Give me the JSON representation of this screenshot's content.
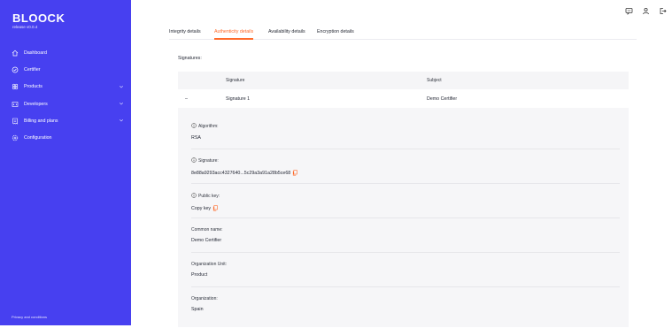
{
  "sidebar": {
    "logo": "BLOOCK",
    "release": "release v0.0.4",
    "items": [
      {
        "label": "Dashboard",
        "icon": "home-icon"
      },
      {
        "label": "Certifier",
        "icon": "certifier-icon"
      },
      {
        "label": "Products",
        "icon": "products-icon",
        "expandable": true
      },
      {
        "label": "Developers",
        "icon": "developers-icon",
        "expandable": true
      },
      {
        "label": "Billing and plans",
        "icon": "billing-icon",
        "expandable": true
      },
      {
        "label": "Configuration",
        "icon": "gear-icon"
      }
    ],
    "privacy": "Privacy and conditions"
  },
  "topbar": {
    "icons": [
      "chat-icon",
      "user-icon",
      "logout-icon"
    ]
  },
  "tabs": [
    {
      "label": "Integrity details",
      "active": false
    },
    {
      "label": "Authenticity details",
      "active": true
    },
    {
      "label": "Availability details",
      "active": false
    },
    {
      "label": "Encryption details",
      "active": false
    }
  ],
  "signatures": {
    "label": "Signatures:",
    "columns": [
      "Signature",
      "Subject"
    ],
    "rows": [
      {
        "toggle": "–",
        "signature": "Signature 1",
        "subject": "Demo Certifier"
      }
    ],
    "details": [
      {
        "label": "Algorithm:",
        "value": "RSA",
        "info": true
      },
      {
        "label": "Signature:",
        "value": "8e88a9293acc4327640...5c29a3a91a28b5ce68",
        "info": true,
        "copy": true
      },
      {
        "label": "Public key:",
        "value": "Copy key",
        "info": true,
        "copy": true
      },
      {
        "label": "Common name:",
        "value": "Demo Certifier"
      },
      {
        "label": "Organization Unit:",
        "value": "Product"
      },
      {
        "label": "Organization:",
        "value": "Spain"
      }
    ]
  },
  "colors": {
    "brand": "#4740f0",
    "accent": "#ff6a2a",
    "panel": "#f6f6f8"
  }
}
